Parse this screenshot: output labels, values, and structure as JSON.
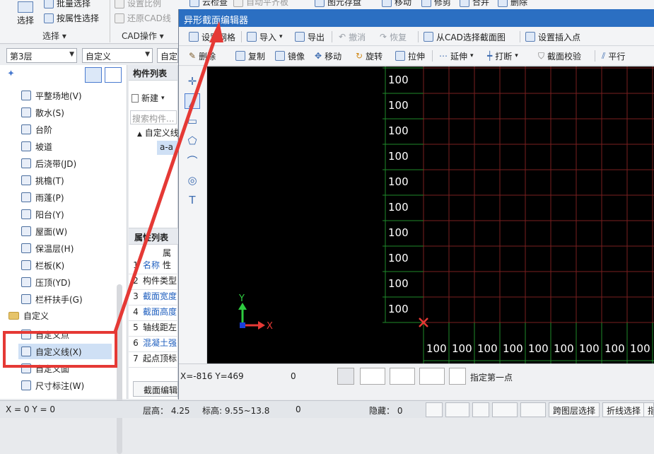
{
  "ribbon": {
    "select_label": "选择",
    "batch_select": "批量选择",
    "attr_select": "按属性选择",
    "select_group": "选择 ▾",
    "set_scale": "设置比例",
    "restore_cad": "还原CAD线",
    "cad_group": "CAD操作 ▾",
    "cloud_check": "云检查",
    "auto_slab": "自动平齐板",
    "element_save": "图元存盘",
    "move": "移动",
    "trim": "修剪",
    "merge": "合并",
    "delete": "删除"
  },
  "selectors": {
    "floor": "第3层",
    "type": "自定义",
    "sub": "自定"
  },
  "tree": {
    "items": [
      {
        "label": "平整场地(V)",
        "icon": "level-site-icon"
      },
      {
        "label": "散水(S)",
        "icon": "apron-icon"
      },
      {
        "label": "台阶",
        "icon": "steps-icon"
      },
      {
        "label": "坡道",
        "icon": "ramp-icon"
      },
      {
        "label": "后浇带(JD)",
        "icon": "post-cast-icon"
      },
      {
        "label": "挑檐(T)",
        "icon": "eave-icon"
      },
      {
        "label": "雨蓬(P)",
        "icon": "canopy-icon"
      },
      {
        "label": "阳台(Y)",
        "icon": "balcony-icon"
      },
      {
        "label": "屋面(W)",
        "icon": "roof-icon"
      },
      {
        "label": "保温层(H)",
        "icon": "insulation-icon"
      },
      {
        "label": "栏板(K)",
        "icon": "parapet-icon"
      },
      {
        "label": "压顶(YD)",
        "icon": "coping-icon"
      },
      {
        "label": "栏杆扶手(G)",
        "icon": "railing-icon"
      }
    ],
    "group": "自定义",
    "sub_items": [
      {
        "label": "自定义点",
        "icon": "custom-point-icon"
      },
      {
        "label": "自定义线(X)",
        "icon": "custom-line-icon"
      },
      {
        "label": "自定义面",
        "icon": "custom-face-icon"
      },
      {
        "label": "尺寸标注(W)",
        "icon": "dimension-icon"
      }
    ]
  },
  "mid": {
    "component_list": "构件列表",
    "new_btn": "新建",
    "search_placeholder": "搜索构件...",
    "tree_root": "自定义线",
    "tree_child": "a-a",
    "prop_list": "属性列表",
    "prop_col": "属性",
    "props": [
      {
        "n": "1",
        "label": "名称"
      },
      {
        "n": "2",
        "label": "构件类型"
      },
      {
        "n": "3",
        "label": "截面宽度"
      },
      {
        "n": "4",
        "label": "截面高度"
      },
      {
        "n": "5",
        "label": "轴线距左"
      },
      {
        "n": "6",
        "label": "混凝土强"
      },
      {
        "n": "7",
        "label": "起点顶标"
      }
    ],
    "section_edit": "截面编辑"
  },
  "editor": {
    "title": "异形截面编辑器",
    "tb1": {
      "grid": "设置网格",
      "import": "导入",
      "export": "导出",
      "undo": "撤消",
      "redo": "恢复",
      "from_cad": "从CAD选择截面图",
      "insert_point": "设置插入点"
    },
    "tb2": {
      "delete": "删除",
      "copy": "复制",
      "mirror": "镜像",
      "move": "移动",
      "rotate": "旋转",
      "stretch": "拉伸",
      "extend": "延伸",
      "break": "打断",
      "check": "截面校验",
      "parallel": "平行"
    },
    "status": {
      "coords": "X=-816 Y=469",
      "value": "0",
      "prompt": "指定第一点"
    },
    "axis": {
      "x": "X",
      "y": "Y"
    },
    "grid_left_labels": [
      "100",
      "100",
      "100",
      "100",
      "100",
      "100",
      "100",
      "100",
      "100",
      "100"
    ],
    "grid_bottom_labels": [
      "100",
      "100",
      "100",
      "100",
      "100",
      "100",
      "100",
      "100",
      "100"
    ]
  },
  "statusbar": {
    "coords": "X = 0 Y = 0",
    "floor_height": "层高： 4.25",
    "elevation": "标高: 9.55~13.8",
    "zero": "0",
    "hidden": "隐藏：  0",
    "cross_floor": "跨图层选择",
    "polyline_select": "折线选择",
    "specify": "指定"
  },
  "colors": {
    "title_blue": "#2b6fc2",
    "grid_red": "#7a1f1f",
    "grid_green": "#1f8a2a",
    "highlight_red": "#e53935",
    "selected_bg": "#cfe0f5"
  }
}
